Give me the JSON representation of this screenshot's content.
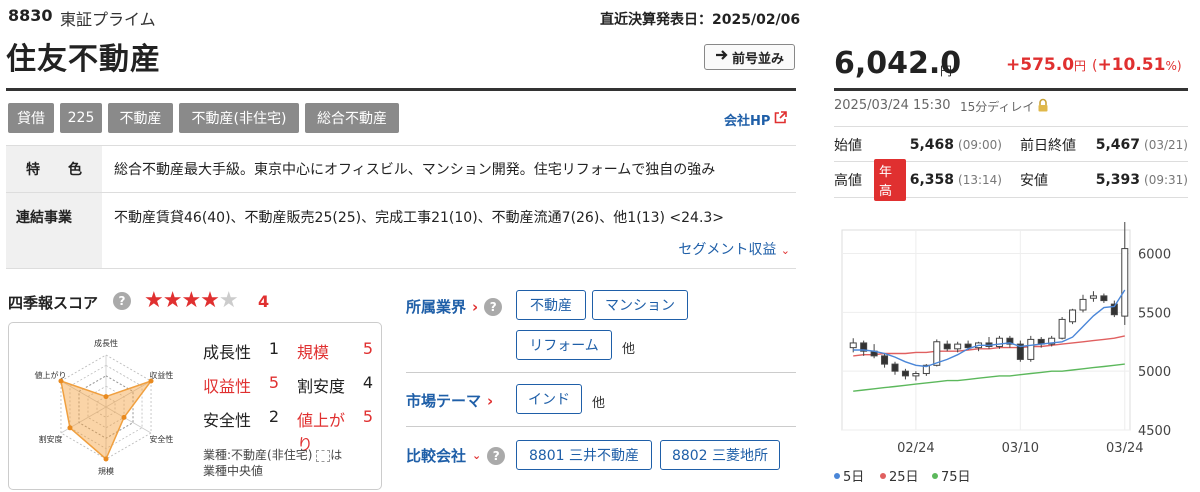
{
  "header": {
    "code": "8830",
    "market": "東証プライム",
    "financial_date": "直近決算発表日：2025/02/06",
    "name": "住友不動産",
    "prev_button": "前号並み"
  },
  "tags": [
    "貸借",
    "225",
    "不動産",
    "不動産(非住宅)",
    "総合不動産"
  ],
  "company_hp": "会社HP",
  "info": {
    "feature_label": [
      "特",
      "色"
    ],
    "feature_text": "総合不動産最大手級。東京中心にオフィスビル、マンション開発。住宅リフォームで独自の強み",
    "business_label": "連結事業",
    "business_text": "不動産賃貸46(40)、不動産販売25(25)、完成工事21(10)、不動産流通7(26)、他1(13) <24.3>",
    "segment_link": "セグメント収益"
  },
  "score": {
    "title": "四季報スコア",
    "help": "?",
    "stars_filled": "★★★★",
    "stars_empty": "★",
    "stars_value": "4",
    "items": [
      {
        "label": "成長性",
        "value": "1",
        "highlight": false
      },
      {
        "label": "規模",
        "value": "5",
        "highlight": true
      },
      {
        "label": "収益性",
        "value": "5",
        "highlight": true
      },
      {
        "label": "割安度",
        "value": "4",
        "highlight": false
      },
      {
        "label": "安全性",
        "value": "2",
        "highlight": false
      },
      {
        "label": "値上がり",
        "value": "5",
        "highlight": true
      }
    ],
    "note_prefix": "業種:不動産(非住宅)",
    "note_suffix": "は",
    "note_line2": "業種中央値",
    "radar_axes": [
      "成長性",
      "収益性",
      "安全性",
      "規模",
      "割安度",
      "値上がり"
    ],
    "radar_values": [
      1,
      5,
      2,
      5,
      4,
      5
    ],
    "radar_industry": [
      3,
      3,
      3,
      3,
      3,
      3
    ]
  },
  "industry": {
    "title": "所属業界",
    "chips": [
      "不動産",
      "マンション",
      "リフォーム"
    ],
    "other": "他"
  },
  "theme": {
    "title": "市場テーマ",
    "chips": [
      "インド"
    ],
    "other": "他"
  },
  "compare": {
    "title": "比較会社",
    "chips": [
      "8801 三井不動産",
      "8802 三菱地所"
    ]
  },
  "quote": {
    "price": "6,042.0",
    "price_unit": "円",
    "change": "+575.0",
    "change_unit": "円",
    "change_pct_open": "(",
    "change_pct": "+10.51",
    "change_pct_unit": "%)",
    "timestamp": "2025/03/24 15:30",
    "delay": "15分ディレイ",
    "open_label": "始値",
    "open": "5,468",
    "open_time": "(09:00)",
    "prev_label": "前日終値",
    "prev": "5,467",
    "prev_time": "(03/21)",
    "high_label": "高値",
    "high_badge": "年高",
    "high": "6,358",
    "high_time": "(13:14)",
    "low_label": "安値",
    "low": "5,393",
    "low_time": "(09:31)"
  },
  "chart_data": {
    "type": "line",
    "yticks": [
      "6000",
      "5500",
      "5000",
      "4500"
    ],
    "ylim": [
      4500,
      6200
    ],
    "xticks": [
      "02/24",
      "03/10",
      "03/24"
    ],
    "series": [
      {
        "name": "5日",
        "color": "#4a86d8"
      },
      {
        "name": "25日",
        "color": "#e06060"
      },
      {
        "name": "75日",
        "color": "#5cb85c"
      }
    ],
    "candles": [
      [
        5200,
        5280,
        5160,
        5240
      ],
      [
        5240,
        5260,
        5130,
        5170
      ],
      [
        5170,
        5230,
        5110,
        5130
      ],
      [
        5130,
        5150,
        5030,
        5060
      ],
      [
        5060,
        5080,
        4970,
        5000
      ],
      [
        5000,
        5020,
        4930,
        4960
      ],
      [
        4960,
        5000,
        4920,
        4980
      ],
      [
        4980,
        5060,
        4960,
        5050
      ],
      [
        5050,
        5270,
        5040,
        5250
      ],
      [
        5230,
        5260,
        5170,
        5190
      ],
      [
        5190,
        5250,
        5160,
        5230
      ],
      [
        5230,
        5260,
        5180,
        5200
      ],
      [
        5200,
        5250,
        5170,
        5240
      ],
      [
        5240,
        5290,
        5190,
        5210
      ],
      [
        5210,
        5300,
        5190,
        5280
      ],
      [
        5280,
        5300,
        5200,
        5230
      ],
      [
        5230,
        5260,
        5080,
        5100
      ],
      [
        5100,
        5300,
        5080,
        5270
      ],
      [
        5270,
        5290,
        5200,
        5230
      ],
      [
        5230,
        5300,
        5210,
        5280
      ],
      [
        5280,
        5460,
        5270,
        5440
      ],
      [
        5420,
        5530,
        5400,
        5520
      ],
      [
        5520,
        5650,
        5500,
        5610
      ],
      [
        5620,
        5680,
        5590,
        5640
      ],
      [
        5640,
        5660,
        5580,
        5600
      ],
      [
        5570,
        5600,
        5460,
        5480
      ],
      [
        5468,
        6358,
        5393,
        6042
      ]
    ],
    "ma5": [
      5180,
      5180,
      5170,
      5150,
      5120,
      5080,
      5050,
      5040,
      5070,
      5100,
      5140,
      5190,
      5220,
      5220,
      5230,
      5240,
      5210,
      5220,
      5230,
      5240,
      5250,
      5290,
      5380,
      5470,
      5540,
      5550,
      5690
    ],
    "ma25": [
      5130,
      5140,
      5140,
      5150,
      5150,
      5150,
      5160,
      5160,
      5170,
      5170,
      5170,
      5180,
      5190,
      5190,
      5200,
      5200,
      5200,
      5210,
      5210,
      5220,
      5230,
      5240,
      5250,
      5260,
      5270,
      5280,
      5300
    ],
    "ma75": [
      4830,
      4840,
      4850,
      4860,
      4870,
      4880,
      4890,
      4900,
      4910,
      4920,
      4920,
      4930,
      4940,
      4950,
      4960,
      4960,
      4970,
      4980,
      4990,
      5000,
      5000,
      5010,
      5020,
      5030,
      5040,
      5050,
      5060
    ]
  }
}
